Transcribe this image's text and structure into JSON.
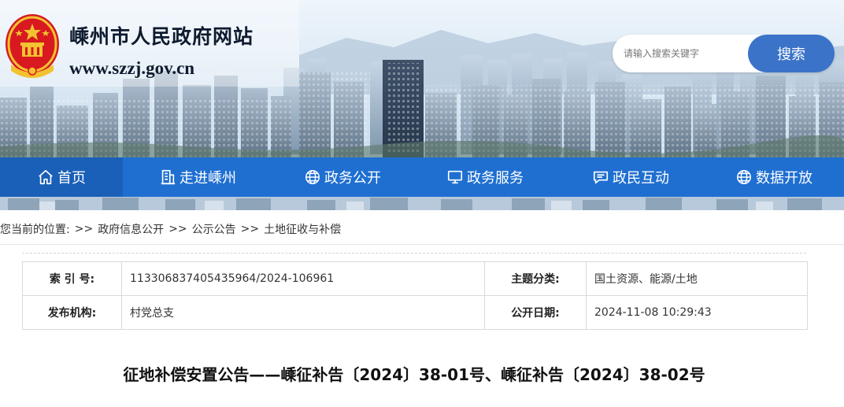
{
  "site": {
    "title": "嵊州市人民政府网站",
    "domain": "www.szzj.gov.cn"
  },
  "search": {
    "placeholder": "请输入搜索关键字",
    "button_label": "搜索"
  },
  "nav": {
    "items": [
      {
        "label": "首页",
        "icon": "home-icon",
        "active": true
      },
      {
        "label": "走进嵊州",
        "icon": "building-icon",
        "active": false
      },
      {
        "label": "政务公开",
        "icon": "globe-icon",
        "active": false
      },
      {
        "label": "政务服务",
        "icon": "monitor-icon",
        "active": false
      },
      {
        "label": "政民互动",
        "icon": "chat-icon",
        "active": false
      },
      {
        "label": "数据开放",
        "icon": "globe-icon",
        "active": false
      }
    ]
  },
  "breadcrumb": {
    "prefix": "您当前的位置:",
    "separator": ">>",
    "items": [
      "政府信息公开",
      "公示公告",
      "土地征收与补偿"
    ]
  },
  "meta": {
    "index_label": "索 引 号:",
    "index_value": "113306837405435964/2024-106961",
    "topic_label": "主题分类:",
    "topic_value": "国土资源、能源/土地",
    "publisher_label": "发布机构:",
    "publisher_value": "村党总支",
    "date_label": "公开日期:",
    "date_value": "2024-11-08 10:29:43"
  },
  "article": {
    "title": "征地补偿安置公告——嵊征补告〔2024〕38-01号、嵊征补告〔2024〕38-02号"
  },
  "colors": {
    "nav_bg": "#1f6fd1",
    "nav_active_bg": "#1a5fb8",
    "search_button_bg": "#3b73c9",
    "emblem_red": "#d8191f",
    "emblem_gold": "#f2c230"
  }
}
